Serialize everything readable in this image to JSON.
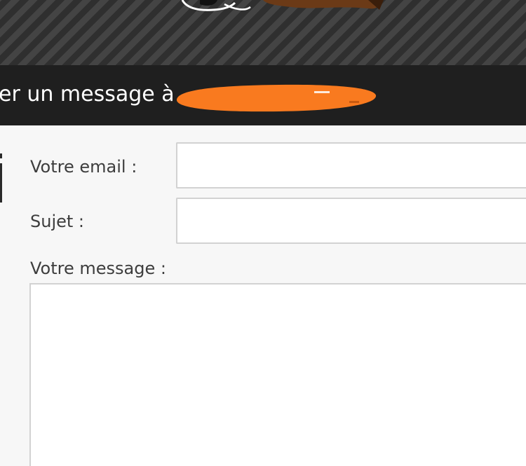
{
  "banner": {
    "art_colors": {
      "outline": "#ffffff",
      "brown": "#6b3a17"
    }
  },
  "dialog": {
    "title_prefix": "er un message à",
    "redaction_color": "#f97a1f"
  },
  "form": {
    "email": {
      "label": "Votre email :",
      "value": ""
    },
    "subject": {
      "label": "Sujet :",
      "value": ""
    },
    "message": {
      "label": "Votre message :",
      "value": ""
    }
  },
  "colors": {
    "banner_stripe_light": "#444444",
    "banner_stripe_dark": "#2f2f2f",
    "title_bar": "#1f1f1f",
    "panel": "#f7f7f7",
    "input_border": "#d2d2d2",
    "label_text": "#3d3d3d"
  }
}
